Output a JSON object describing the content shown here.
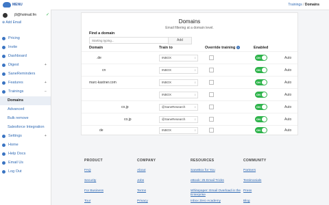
{
  "topbar": {
    "menu_label": "MENU",
    "breadcrumb_parent": "Trainings",
    "breadcrumb_sep": "/",
    "breadcrumb_current": "Domains"
  },
  "account": {
    "name": "j9@hotmail.fm",
    "add_email": "Add Email"
  },
  "sidebar": {
    "items": [
      {
        "label": "Pricing",
        "icon": "dollar-icon"
      },
      {
        "label": "Invite",
        "icon": "person-add-icon"
      },
      {
        "label": "Dashboard",
        "icon": "dashboard-icon"
      },
      {
        "label": "Digest",
        "icon": "digest-icon"
      },
      {
        "label": "SaneReminders",
        "icon": "bell-icon"
      },
      {
        "label": "Features",
        "icon": "features-icon"
      },
      {
        "label": "Trainings",
        "icon": "trainings-icon"
      }
    ],
    "subitems": [
      "Domains",
      "Advanced",
      "Bulk remove",
      "Salesforce Integration"
    ],
    "bottom": [
      {
        "label": "Settings",
        "icon": "gear-icon"
      },
      {
        "label": "Home",
        "icon": "home-icon"
      },
      {
        "label": "Help Docs",
        "icon": "help-icon"
      },
      {
        "label": "Email Us",
        "icon": "mail-icon"
      },
      {
        "label": "Log Out",
        "icon": "logout-icon"
      }
    ]
  },
  "panel": {
    "title": "Domains",
    "subtitle": "Email filtering at a domain level.",
    "find_label": "Find a domain",
    "find_placeholder": "Starting typing...",
    "add_button": "Add",
    "headers": {
      "domain": "Domain",
      "train_to": "Train to",
      "override": "Override training",
      "enabled": "Enabled"
    },
    "rows": [
      {
        "domain": ".de",
        "train_to": "INBOX",
        "enabled": "ON",
        "extra": "Auto"
      },
      {
        "domain": "cn",
        "train_to": "INBOX",
        "enabled": "ON",
        "extra": "Auto"
      },
      {
        "domain": "marc-kastner.com",
        "train_to": "INBOX",
        "enabled": "ON",
        "extra": "Auto"
      },
      {
        "domain": "",
        "train_to": "INBOX",
        "enabled": "ON",
        "extra": "Auto"
      },
      {
        "domain": "co.jp",
        "train_to": "@SaneResearch",
        "enabled": "ON",
        "extra": "Auto"
      },
      {
        "domain": "co.jp",
        "train_to": "@SaneResearch",
        "enabled": "ON",
        "extra": "Auto"
      },
      {
        "domain": "de",
        "train_to": "INBOX",
        "enabled": "ON",
        "extra": "Auto"
      }
    ]
  },
  "footer": {
    "columns": [
      {
        "title": "PRODUCT",
        "links": [
          "FAQ",
          "Security",
          "For Business",
          "Tour"
        ]
      },
      {
        "title": "COMPANY",
        "links": [
          "About",
          "Jobs",
          "Terms",
          "Privacy"
        ]
      },
      {
        "title": "RESOURCES",
        "links": [
          "SaneBox for You",
          "eBook: 25 Email Tricks",
          "Whitepaper: Email Overload in the Enterprise",
          "Inbox Zero Academy"
        ]
      },
      {
        "title": "COMMUNITY",
        "links": [
          "Partners",
          "Testimonials",
          "Press",
          "Blog"
        ]
      }
    ]
  },
  "colors": {
    "accent": "#2f69b3",
    "toggle_on": "#2db34a"
  }
}
